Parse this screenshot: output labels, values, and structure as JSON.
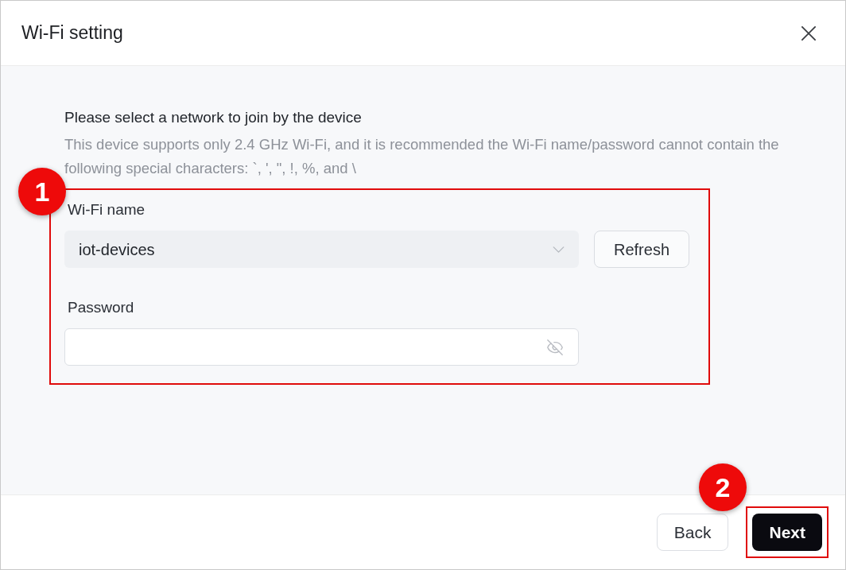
{
  "dialog": {
    "title": "Wi-Fi setting"
  },
  "intro": {
    "heading": "Please select a network to join by the device",
    "description": "This device supports only 2.4 GHz Wi-Fi, and it is recommended the Wi-Fi name/password cannot contain the following special characters: `, ', \", !, %, and \\"
  },
  "form": {
    "annotation": "1",
    "wifi_name": {
      "label": "Wi-Fi name",
      "value": "iot-devices"
    },
    "refresh_button": "Refresh",
    "password": {
      "label": "Password"
    }
  },
  "buttons": [
    {
      "label": "Back",
      "kind": "secondary"
    },
    {
      "label": "Next",
      "kind": "primary",
      "annotation": "2"
    }
  ]
}
